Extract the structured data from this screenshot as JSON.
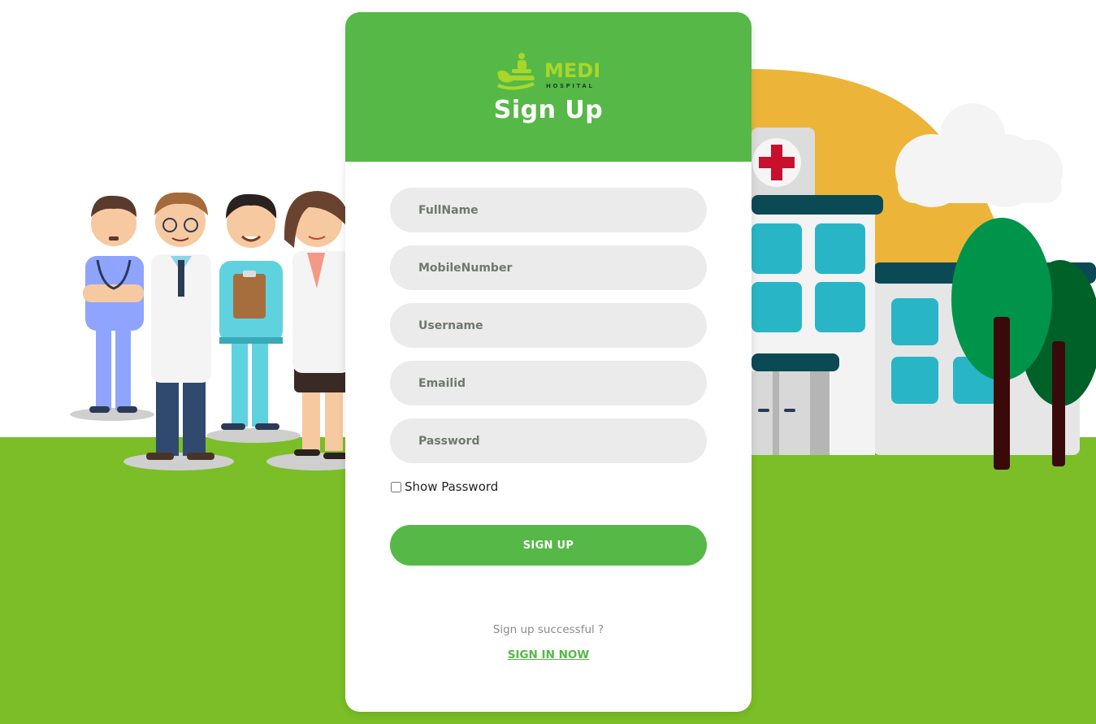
{
  "logo": {
    "brand": "MEDI",
    "sub": "HOSPITAL",
    "icon": "hospital-care-icon"
  },
  "form": {
    "title": "Sign Up",
    "fields": {
      "fullname": {
        "placeholder": "FullName",
        "value": ""
      },
      "mobile": {
        "placeholder": "MobileNumber",
        "value": ""
      },
      "username": {
        "placeholder": "Username",
        "value": ""
      },
      "email": {
        "placeholder": "Emailid",
        "value": ""
      },
      "password": {
        "placeholder": "Password",
        "value": ""
      }
    },
    "show_password_label": "Show Password",
    "show_password_checked": false,
    "submit_label": "SIGN UP",
    "footer_text": "Sign up successful ?",
    "signin_link": "SIGN IN NOW"
  },
  "colors": {
    "accent": "#56b847",
    "grass": "#7bbe27",
    "sun": "#ecb53a",
    "field_bg": "#ebebeb"
  },
  "illustration": {
    "left": "medical-staff-group",
    "right": "hospital-building-with-trees"
  }
}
